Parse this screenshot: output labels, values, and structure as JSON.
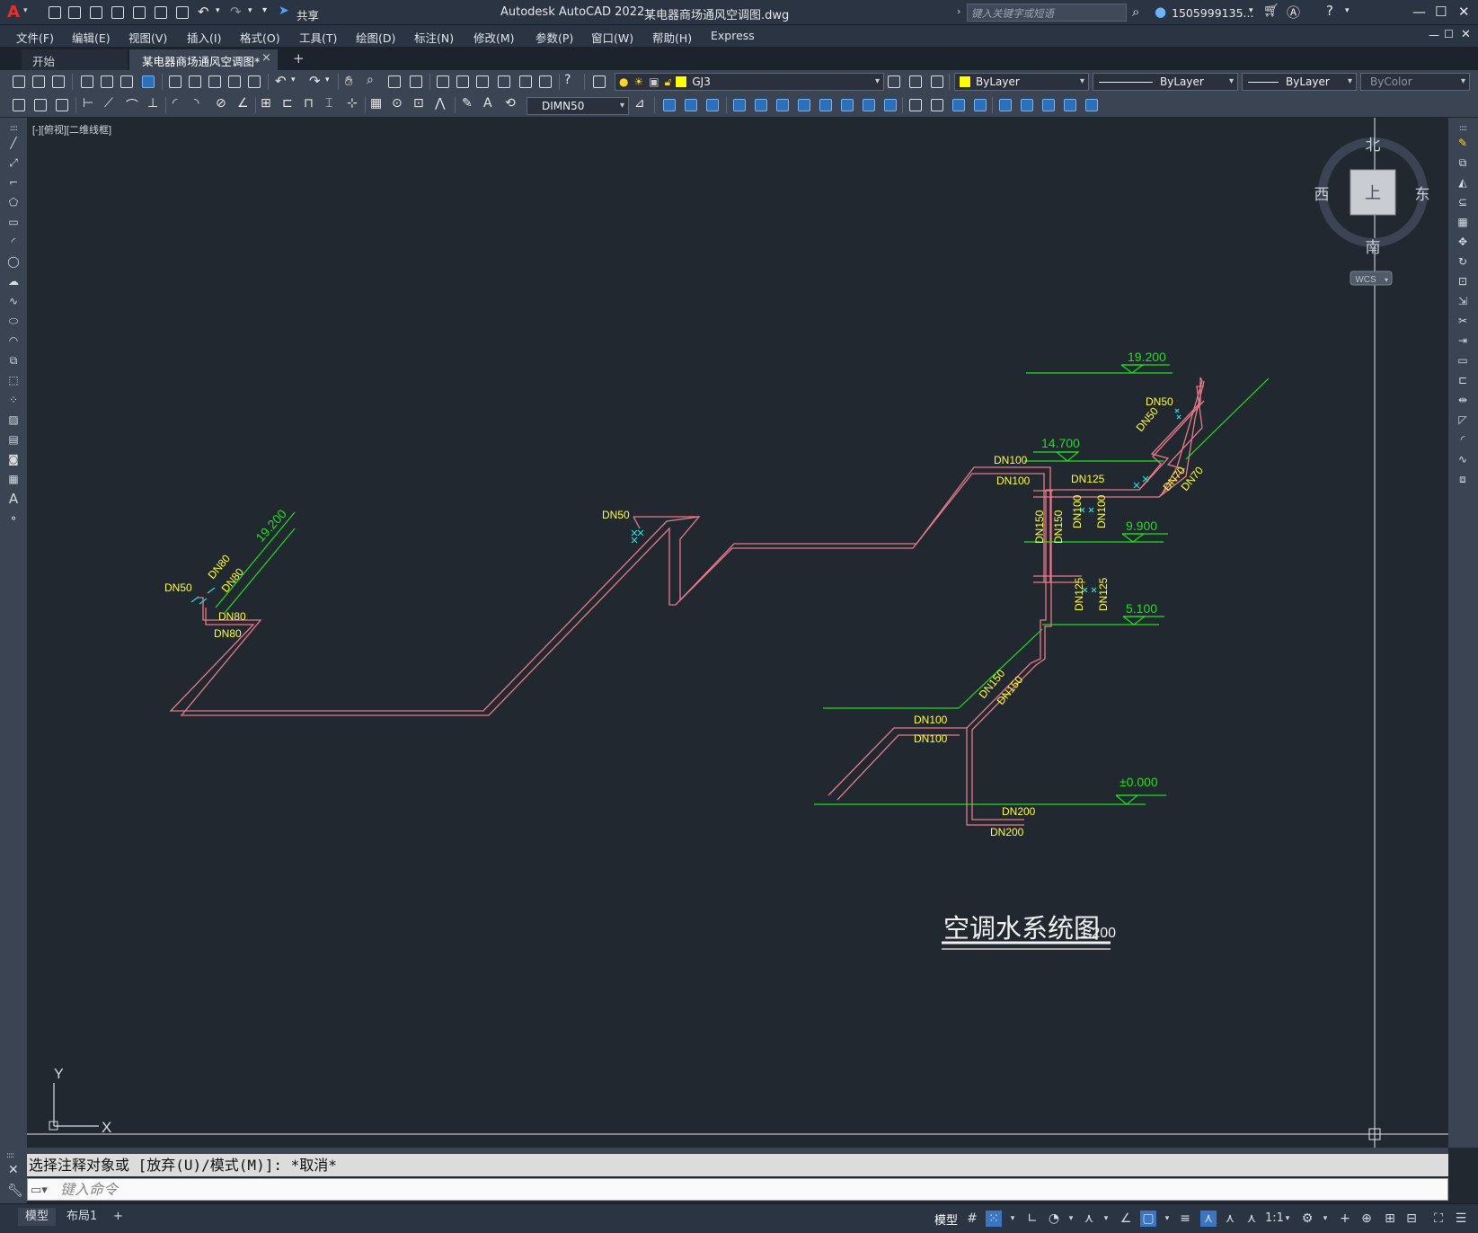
{
  "app": {
    "title": "Autodesk AutoCAD 2022",
    "filename": "某电器商场通风空调图.dwg",
    "logo_letter": "A",
    "share_label": "共享",
    "search_placeholder": "键入关键字或短语",
    "user": "1505999135...",
    "window_controls": [
      "—",
      "☐",
      "✕"
    ]
  },
  "menu": [
    "文件(F)",
    "编辑(E)",
    "视图(V)",
    "插入(I)",
    "格式(O)",
    "工具(T)",
    "绘图(D)",
    "标注(N)",
    "修改(M)",
    "参数(P)",
    "窗口(W)",
    "帮助(H)",
    "Express"
  ],
  "tabs": {
    "start": "开始",
    "active": "某电器商场通风空调图*",
    "close": "×",
    "add": "+"
  },
  "toolbar": {
    "layer": "GJ3",
    "layer_color": "#ffff00",
    "color": "ByLayer",
    "linetype": "ByLayer",
    "lineweight": "ByLayer",
    "plotstyle": "ByColor",
    "dimstyle": "DIMN50"
  },
  "viewport": {
    "label": "[-][俯视][二维线框]",
    "viewcube": {
      "north": "北",
      "south": "南",
      "east": "东",
      "west": "西",
      "top": "上",
      "wcs": "WCS"
    },
    "ucs": {
      "x": "X",
      "y": "Y"
    }
  },
  "drawing": {
    "title": "空调水系统图",
    "scale": "1:200",
    "levels": [
      "19.200",
      "14.700",
      "9.900",
      "5.100",
      "±0.000",
      "19.200"
    ],
    "pipe_labels": [
      "DN50",
      "DN50",
      "DN50",
      "DN50",
      "DN80",
      "DN80",
      "DN80",
      "DN80",
      "DN100",
      "DN100",
      "DN125",
      "DN150",
      "DN150",
      "DN100",
      "DN100",
      "DN70",
      "DN70",
      "DN125",
      "DN125",
      "DN150",
      "DN150",
      "DN100",
      "DN100",
      "DN200",
      "DN200"
    ],
    "colors": {
      "pipe": "#e87a8a",
      "level": "#1fe01f",
      "label": "#ffff33",
      "valve": "#1fe0e0",
      "bg": "#212830"
    }
  },
  "command": {
    "history": "选择注释对象或 [放弃(U)/模式(M)]: *取消*",
    "placeholder": "键入命令"
  },
  "status": {
    "tabs": [
      "模型",
      "布局1",
      "+"
    ],
    "right_label": "模型",
    "scale": "1:1"
  }
}
